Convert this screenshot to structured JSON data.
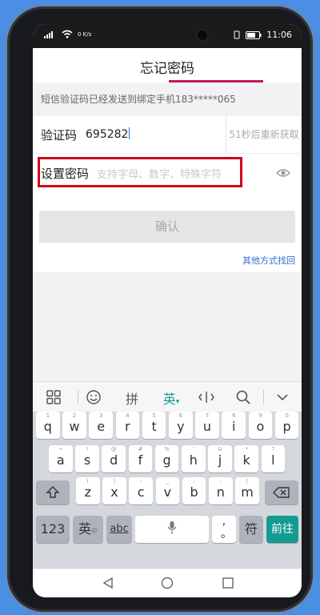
{
  "status": {
    "time": "11:06",
    "network_speed": "0 K/s"
  },
  "header": {
    "title": "忘记密码"
  },
  "notice": {
    "text": "短信验证码已经发送到绑定手机183*****065"
  },
  "verify": {
    "label": "验证码",
    "value": "695282",
    "resend": "51秒后重新获取"
  },
  "password": {
    "label": "设置密码",
    "placeholder": "支持字母、数字、特殊字符"
  },
  "confirm_label": "确认",
  "other_methods": "其他方式找回",
  "keyboard": {
    "toolbar": {
      "pinyin": "拼",
      "english": "英"
    },
    "row1": [
      {
        "sub": "1",
        "ch": "q"
      },
      {
        "sub": "2",
        "ch": "w"
      },
      {
        "sub": "3",
        "ch": "e"
      },
      {
        "sub": "4",
        "ch": "r"
      },
      {
        "sub": "5",
        "ch": "t"
      },
      {
        "sub": "6",
        "ch": "y"
      },
      {
        "sub": "7",
        "ch": "u"
      },
      {
        "sub": "8",
        "ch": "i"
      },
      {
        "sub": "9",
        "ch": "o"
      },
      {
        "sub": "0",
        "ch": "p"
      }
    ],
    "row2": [
      {
        "sub": "~",
        "ch": "a"
      },
      {
        "sub": "!",
        "ch": "s"
      },
      {
        "sub": "@",
        "ch": "d"
      },
      {
        "sub": "#",
        "ch": "f"
      },
      {
        "sub": "%",
        "ch": "g"
      },
      {
        "sub": "'",
        "ch": "h"
      },
      {
        "sub": "&",
        "ch": "j"
      },
      {
        "sub": "*",
        "ch": "k"
      },
      {
        "sub": "?",
        "ch": "l"
      }
    ],
    "row3": [
      {
        "sub": "(",
        "ch": "z"
      },
      {
        "sub": ")",
        "ch": "x"
      },
      {
        "sub": "-",
        "ch": "c"
      },
      {
        "sub": "_",
        "ch": "v"
      },
      {
        "sub": ":",
        "ch": "b"
      },
      {
        "sub": ";",
        "ch": "n"
      },
      {
        "sub": "/",
        "ch": "m"
      }
    ],
    "num_key": "123",
    "lang_key": "英",
    "lang_sub": "中",
    "abc_key": "abc",
    "comma_key": ",",
    "period_key": "。",
    "symbol_key": "符",
    "go_key": "前往"
  }
}
